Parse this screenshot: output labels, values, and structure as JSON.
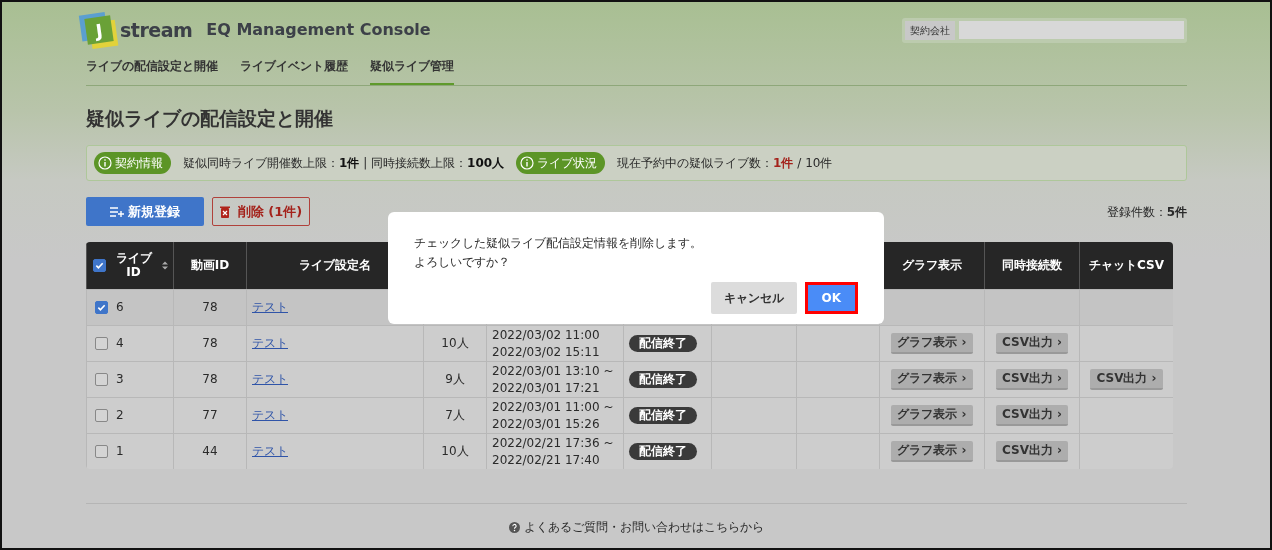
{
  "header": {
    "logo_mark": "J",
    "logo_text": "stream",
    "app_title": "EQ Management Console"
  },
  "company_field": {
    "label": "契約会社"
  },
  "nav_tabs": [
    {
      "label": "ライブの配信設定と開催",
      "selected": false
    },
    {
      "label": "ライブイベント履歴",
      "selected": false
    },
    {
      "label": "疑似ライブ管理",
      "selected": true
    }
  ],
  "page_title": "疑似ライブの配信設定と開催",
  "info_bar": [
    {
      "kind": "limits",
      "badge": "契約情報",
      "text": "疑似同時ライブ開催数上限：**1件** | 同時接続数上限：**100人**"
    },
    {
      "kind": "status",
      "badge": "ライブ状況",
      "text": "現在予約中の疑似ライブ数：**1件** / 10件"
    }
  ],
  "actions": {
    "new_button": "新規登録",
    "delete_button": "削除 (1件)",
    "count": "登録件数：**5件**"
  },
  "table": {
    "select_all_checked": true,
    "columns": [
      {
        "label": "ライブ ID",
        "sortable": true
      },
      {
        "label": "動画ID"
      },
      {
        "label": "ライブ設定名"
      },
      {},
      {},
      {},
      {},
      {},
      {
        "label": "グラフ表示"
      },
      {
        "label": "同時接続数"
      },
      {
        "label": "チャットCSV"
      }
    ],
    "rows": [
      {
        "checked": true,
        "id": "6",
        "video_id": "78",
        "name": "テスト"
      },
      {
        "checked": false,
        "id": "4",
        "video_id": "78",
        "name": "テスト",
        "viewers": "10人",
        "date_lines": [
          "2022/03/02 11:00",
          "2022/03/02 15:11"
        ],
        "status": "配信終了",
        "graph_button": "グラフ表示 ›",
        "csv_button": "CSV出力 ›"
      },
      {
        "checked": false,
        "id": "3",
        "video_id": "78",
        "name": "テスト",
        "viewers": "9人",
        "date_lines": [
          "2022/03/01 13:10 ~",
          "2022/03/01 17:21"
        ],
        "status": "配信終了",
        "graph_button": "グラフ表示 ›",
        "csv_button": "CSV出力 ›",
        "chat_csv_button": "CSV出力 ›"
      },
      {
        "checked": false,
        "id": "2",
        "video_id": "77",
        "name": "テスト",
        "viewers": "7人",
        "date_lines": [
          "2022/03/01 11:00 ~",
          "2022/03/01 15:26"
        ],
        "status": "配信終了",
        "graph_button": "グラフ表示 ›",
        "csv_button": "CSV出力 ›"
      },
      {
        "checked": false,
        "id": "1",
        "video_id": "44",
        "name": "テスト",
        "viewers": "10人",
        "date_lines": [
          "2022/02/21 17:36 ~",
          "2022/02/21 17:40"
        ],
        "status": "配信終了",
        "graph_button": "グラフ表示 ›",
        "csv_button": "CSV出力 ›"
      }
    ]
  },
  "modal": {
    "message_lines": [
      "チェックした疑似ライブ配信設定情報を削除します。",
      "よろしいですか？"
    ],
    "buttons": [
      {
        "label": "キャンセル",
        "kind": "secondary",
        "focused": false
      },
      {
        "label": "OK",
        "kind": "primary",
        "focused": true
      }
    ]
  },
  "footer": {
    "help_link": "よくあるご質問・お問い合わせはこちらから"
  }
}
